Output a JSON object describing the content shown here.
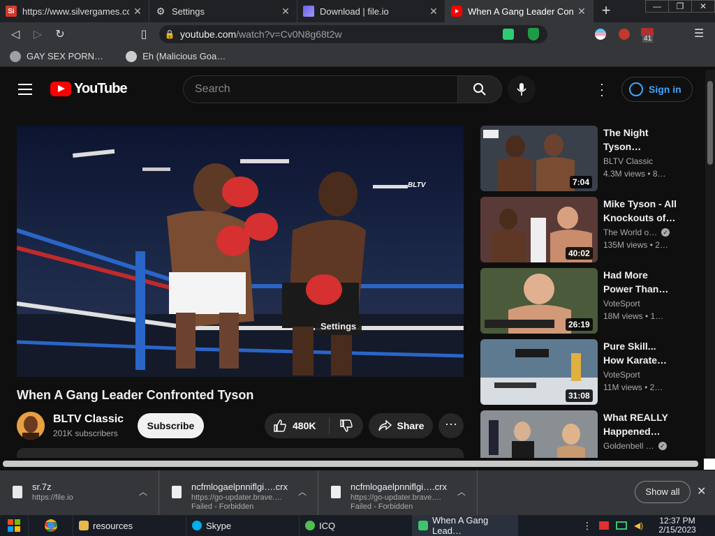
{
  "browser": {
    "tabs": [
      {
        "title": "https://www.silvergames.co",
        "favicon": "Si",
        "active": false
      },
      {
        "title": "Settings",
        "favicon": "gear",
        "active": false
      },
      {
        "title": "Download | file.io",
        "favicon": "file.io",
        "active": false
      },
      {
        "title": "When A Gang Leader Confr",
        "favicon": "youtube",
        "active": true
      }
    ],
    "url_host": "youtube.com",
    "url_path": "/watch?v=Cv0N8g68t2w",
    "extension_badge": "41",
    "bookmarks": [
      {
        "label": "GAY SEX PORN…"
      },
      {
        "label": "Eh (Malicious Goa…"
      }
    ]
  },
  "youtube": {
    "logo": "YouTube",
    "search_placeholder": "Search",
    "sign_in": "Sign in",
    "player_tooltip": "Settings",
    "player_watermark": "BLTV",
    "video_title": "When A Gang Leader Confronted Tyson",
    "channel": {
      "name": "BLTV Classic",
      "subscribers": "201K subscribers"
    },
    "subscribe_label": "Subscribe",
    "likes": "480K",
    "share_label": "Share",
    "recommendations": [
      {
        "title_line1": "The Night",
        "title_line2": "Tyson…",
        "channel": "BLTV Classic",
        "verified": false,
        "views": "4.3M views",
        "age": "• 8…",
        "duration": "7:04",
        "thumb": "#39404a"
      },
      {
        "title_line1": "Mike Tyson - All",
        "title_line2": "Knockouts of…",
        "channel": "The World o…",
        "verified": true,
        "views": "135M views",
        "age": "• 2…",
        "duration": "40:02",
        "thumb": "#5a3a36"
      },
      {
        "title_line1": "Had More",
        "title_line2": "Power Than…",
        "channel": "VoteSport",
        "verified": false,
        "views": "18M views",
        "age": "• 1…",
        "duration": "26:19",
        "thumb": "#4a5a3a"
      },
      {
        "title_line1": "Pure Skill...",
        "title_line2": "How Karate…",
        "channel": "VoteSport",
        "verified": false,
        "views": "11M views",
        "age": "• 2…",
        "duration": "31:08",
        "thumb": "#5e7a90"
      },
      {
        "title_line1": "What REALLY",
        "title_line2": "Happened…",
        "channel": "Goldenbell …",
        "verified": true,
        "views": "",
        "age": "",
        "duration": "",
        "thumb": "#8a8f94"
      }
    ]
  },
  "downloads": {
    "items": [
      {
        "name": "sr.7z",
        "status": "https://file.io"
      },
      {
        "name": "ncfmlogaelpnniflgi….crx",
        "status": "https://go-updater.brave.… Failed - Forbidden"
      },
      {
        "name": "ncfmlogaelpnniflgi….crx",
        "status": "https://go-updater.brave.… Failed - Forbidden"
      }
    ],
    "show_all": "Show all"
  },
  "taskbar": {
    "items": [
      {
        "label": "resources",
        "color": "#e8b84a"
      },
      {
        "label": "Skype",
        "color": "#00aff0"
      },
      {
        "label": "ICQ",
        "color": "#4fc04f"
      },
      {
        "label": "When A Gang Lead…",
        "color": "#3ec46d"
      }
    ],
    "time": "12:37 PM",
    "date": "2/15/2023"
  }
}
